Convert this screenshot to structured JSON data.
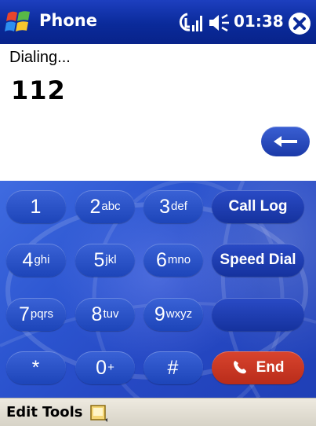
{
  "titlebar": {
    "app_title": "Phone",
    "clock": "01:38",
    "icons": [
      "start-menu-flag-icon",
      "signal-strength-icon",
      "speaker-volume-icon",
      "close-icon"
    ]
  },
  "display": {
    "status": "Dialing...",
    "number": "112",
    "backspace_icon": "backspace-arrow-icon"
  },
  "keypad": {
    "keys": [
      {
        "digit": "1",
        "letters": ""
      },
      {
        "digit": "2",
        "letters": "abc"
      },
      {
        "digit": "3",
        "letters": "def"
      },
      {
        "digit": "4",
        "letters": "ghi"
      },
      {
        "digit": "5",
        "letters": "jkl"
      },
      {
        "digit": "6",
        "letters": "mno"
      },
      {
        "digit": "7",
        "letters": "pqrs"
      },
      {
        "digit": "8",
        "letters": "tuv"
      },
      {
        "digit": "9",
        "letters": "wxyz"
      },
      {
        "digit": "*",
        "letters": ""
      },
      {
        "digit": "0",
        "letters": "+"
      },
      {
        "digit": "#",
        "letters": ""
      }
    ],
    "call_log": "Call Log",
    "speed_dial": "Speed Dial",
    "end": "End"
  },
  "menubar": {
    "edit": "Edit",
    "tools": "Tools",
    "sip_icon": "input-panel-icon"
  },
  "colors": {
    "title_bar": "#0a2a9a",
    "keypad_bg": "#2c55d0",
    "key": "#2a52c8",
    "end_key": "#c93420",
    "menu_bar": "#dedad0"
  }
}
